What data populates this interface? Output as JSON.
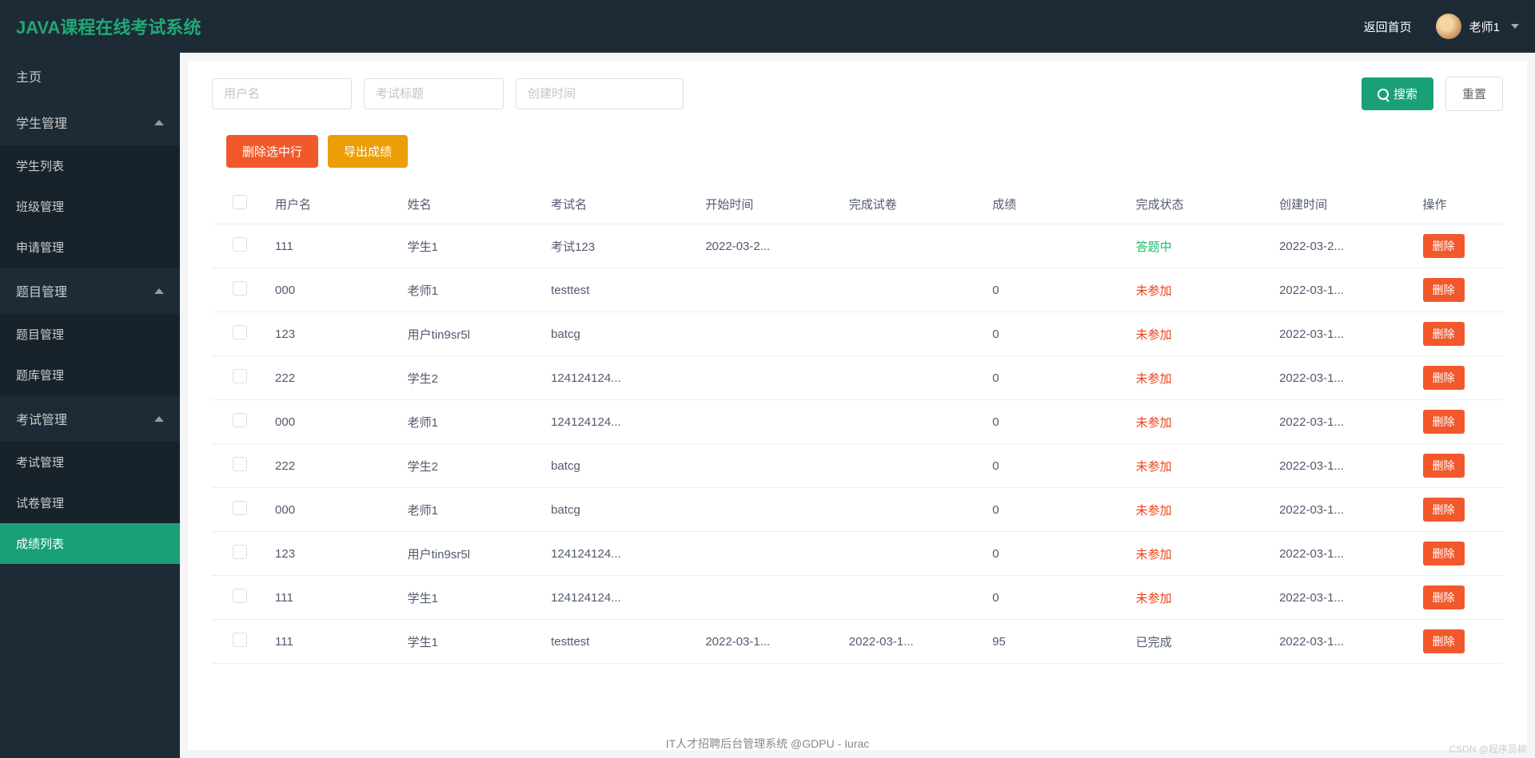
{
  "header": {
    "logo": "JAVA课程在线考试系统",
    "home_link": "返回首页",
    "user_name": "老师1"
  },
  "sidebar": {
    "items": [
      {
        "label": "主页",
        "type": "item"
      },
      {
        "label": "学生管理",
        "type": "group",
        "expanded": true
      },
      {
        "label": "学生列表",
        "type": "sub"
      },
      {
        "label": "班级管理",
        "type": "sub"
      },
      {
        "label": "申请管理",
        "type": "sub"
      },
      {
        "label": "题目管理",
        "type": "group",
        "expanded": true
      },
      {
        "label": "题目管理",
        "type": "sub"
      },
      {
        "label": "题库管理",
        "type": "sub"
      },
      {
        "label": "考试管理",
        "type": "group",
        "expanded": true
      },
      {
        "label": "考试管理",
        "type": "sub"
      },
      {
        "label": "试卷管理",
        "type": "sub"
      },
      {
        "label": "成绩列表",
        "type": "sub",
        "active": true
      }
    ]
  },
  "search": {
    "placeholder_user": "用户名",
    "placeholder_title": "考试标题",
    "placeholder_time": "创建时间",
    "search_btn": "搜索",
    "reset_btn": "重置"
  },
  "actions": {
    "delete_selected": "删除选中行",
    "export": "导出成绩"
  },
  "table": {
    "headers": {
      "user": "用户名",
      "name": "姓名",
      "exam": "考试名",
      "start": "开始时间",
      "end": "完成试卷",
      "score": "成绩",
      "status": "完成状态",
      "create": "创建时间",
      "op": "操作"
    },
    "rows": [
      {
        "user": "111",
        "name": "学生1",
        "exam": "考试123",
        "start": "2022-03-2...",
        "end": "",
        "score": "",
        "status": "答题中",
        "status_cls": "status-green",
        "create": "2022-03-2...",
        "op": "删除"
      },
      {
        "user": "000",
        "name": "老师1",
        "exam": "testtest",
        "start": "",
        "end": "",
        "score": "0",
        "status": "未参加",
        "status_cls": "status-red",
        "create": "2022-03-1...",
        "op": "删除"
      },
      {
        "user": "123",
        "name": "用户tin9sr5l",
        "exam": "batcg",
        "start": "",
        "end": "",
        "score": "0",
        "status": "未参加",
        "status_cls": "status-red",
        "create": "2022-03-1...",
        "op": "删除"
      },
      {
        "user": "222",
        "name": "学生2",
        "exam": "124124124...",
        "start": "",
        "end": "",
        "score": "0",
        "status": "未参加",
        "status_cls": "status-red",
        "create": "2022-03-1...",
        "op": "删除"
      },
      {
        "user": "000",
        "name": "老师1",
        "exam": "124124124...",
        "start": "",
        "end": "",
        "score": "0",
        "status": "未参加",
        "status_cls": "status-red",
        "create": "2022-03-1...",
        "op": "删除"
      },
      {
        "user": "222",
        "name": "学生2",
        "exam": "batcg",
        "start": "",
        "end": "",
        "score": "0",
        "status": "未参加",
        "status_cls": "status-red",
        "create": "2022-03-1...",
        "op": "删除"
      },
      {
        "user": "000",
        "name": "老师1",
        "exam": "batcg",
        "start": "",
        "end": "",
        "score": "0",
        "status": "未参加",
        "status_cls": "status-red",
        "create": "2022-03-1...",
        "op": "删除"
      },
      {
        "user": "123",
        "name": "用户tin9sr5l",
        "exam": "124124124...",
        "start": "",
        "end": "",
        "score": "0",
        "status": "未参加",
        "status_cls": "status-red",
        "create": "2022-03-1...",
        "op": "删除"
      },
      {
        "user": "111",
        "name": "学生1",
        "exam": "124124124...",
        "start": "",
        "end": "",
        "score": "0",
        "status": "未参加",
        "status_cls": "status-red",
        "create": "2022-03-1...",
        "op": "删除"
      },
      {
        "user": "111",
        "name": "学生1",
        "exam": "testtest",
        "start": "2022-03-1...",
        "end": "2022-03-1...",
        "score": "95",
        "status": "已完成",
        "status_cls": "",
        "create": "2022-03-1...",
        "op": "删除"
      }
    ]
  },
  "footer": "IT人才招聘后台管理系统 @GDPU - Iurac",
  "watermark": "CSDN @程序员柳"
}
